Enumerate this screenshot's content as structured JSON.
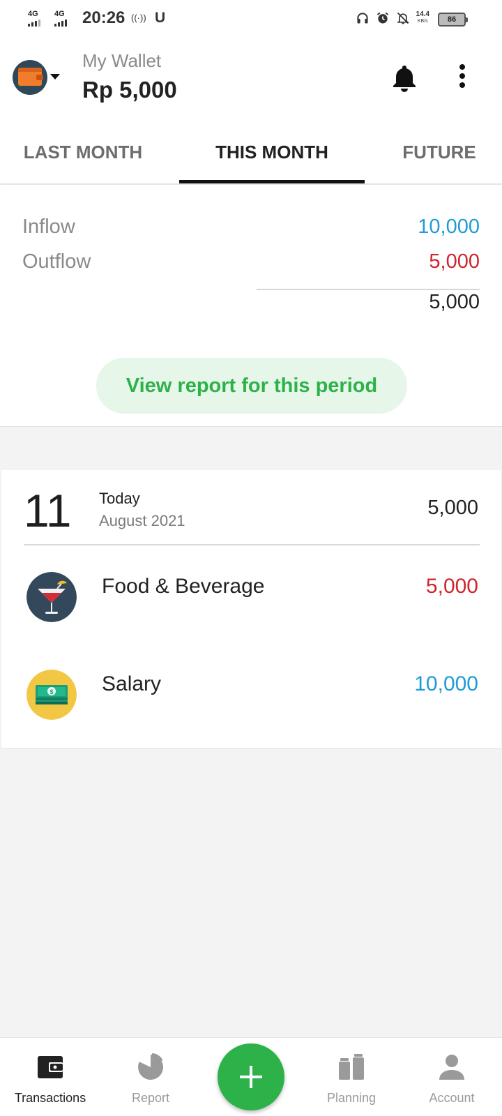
{
  "status_bar": {
    "network1": "4G",
    "network2": "4G",
    "time": "20:26",
    "hotspot": "((·))",
    "u_label": "U",
    "speed_value": "14.4",
    "speed_unit": "KB/s",
    "battery": "86",
    "icons": [
      "headphones-icon",
      "alarm-icon",
      "notifications-off-icon"
    ]
  },
  "header": {
    "wallet_name": "My Wallet",
    "balance": "Rp 5,000",
    "icons": [
      "wallet-icon",
      "chevron-down-icon",
      "bell-icon",
      "more-vert-icon"
    ]
  },
  "tabs": [
    {
      "label": "LAST MONTH",
      "active": false
    },
    {
      "label": "THIS MONTH",
      "active": true
    },
    {
      "label": "FUTURE",
      "active": false
    }
  ],
  "summary": {
    "inflow_label": "Inflow",
    "inflow_value": "10,000",
    "outflow_label": "Outflow",
    "outflow_value": "5,000",
    "net_value": "5,000",
    "report_button": "View report for this period"
  },
  "day_group": {
    "day": "11",
    "relative": "Today",
    "month_year": "August 2021",
    "total": "5,000",
    "transactions": [
      {
        "category": "Food & Beverage",
        "amount": "5,000",
        "type": "expense",
        "icon": "cocktail-icon"
      },
      {
        "category": "Salary",
        "amount": "10,000",
        "type": "income",
        "icon": "money-icon"
      }
    ]
  },
  "bottom_nav": {
    "items": [
      {
        "label": "Transactions",
        "icon": "wallet-icon",
        "active": true
      },
      {
        "label": "Report",
        "icon": "pie-chart-icon",
        "active": false
      },
      {
        "label": "Planning",
        "icon": "planning-icon",
        "active": false
      },
      {
        "label": "Account",
        "icon": "person-icon",
        "active": false
      }
    ],
    "fab_icon": "plus-icon"
  },
  "colors": {
    "income": "#1e9bd7",
    "expense": "#d0242b",
    "accent": "#2db24a",
    "accent_bg": "#e6f6e9"
  }
}
